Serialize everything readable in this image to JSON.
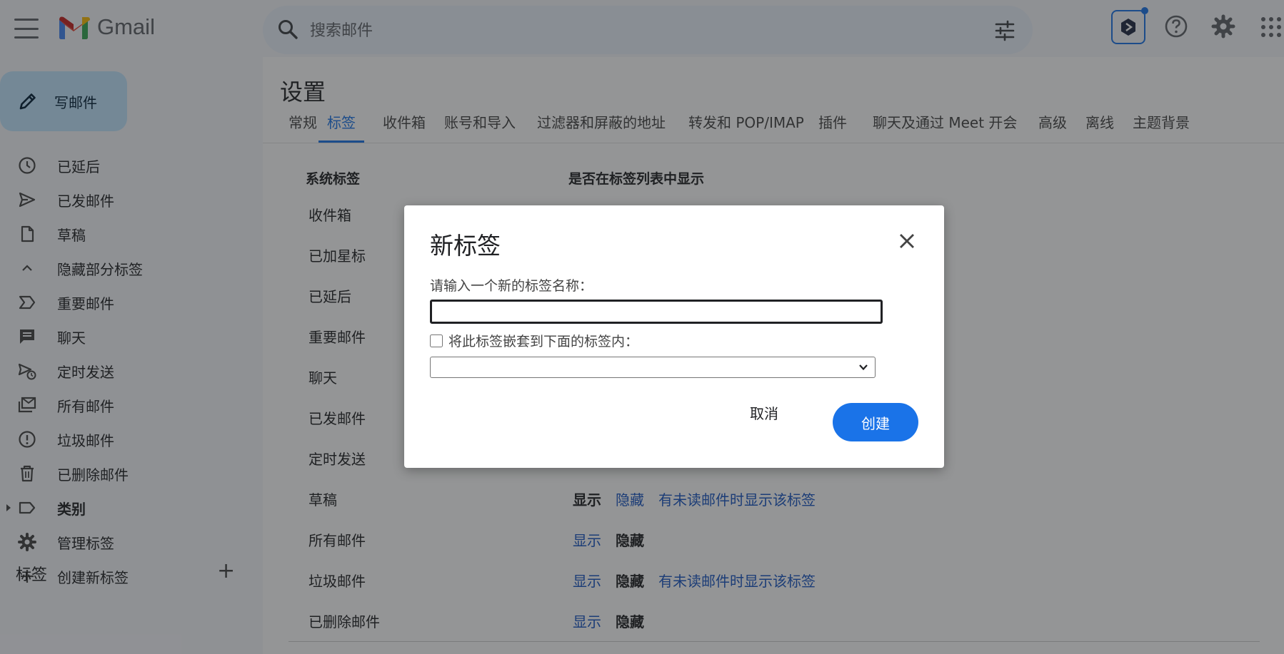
{
  "header": {
    "app_name": "Gmail",
    "search_placeholder": "搜索邮件"
  },
  "sidebar": {
    "compose_label": "写邮件",
    "items": [
      {
        "label": "已延后",
        "icon": "clock-icon"
      },
      {
        "label": "已发邮件",
        "icon": "send-icon"
      },
      {
        "label": "草稿",
        "icon": "draft-icon"
      },
      {
        "label": "隐藏部分标签",
        "icon": "chevron-up-icon"
      },
      {
        "label": "重要邮件",
        "icon": "important-icon"
      },
      {
        "label": "聊天",
        "icon": "chat-icon"
      },
      {
        "label": "定时发送",
        "icon": "scheduled-send-icon"
      },
      {
        "label": "所有邮件",
        "icon": "all-mail-icon"
      },
      {
        "label": "垃圾邮件",
        "icon": "spam-icon"
      },
      {
        "label": "已删除邮件",
        "icon": "trash-icon"
      },
      {
        "label": "类别",
        "icon": "label-icon"
      },
      {
        "label": "管理标签",
        "icon": "gear-icon"
      },
      {
        "label": "创建新标签",
        "icon": "plus-icon"
      }
    ],
    "labels_heading": "标签",
    "labels_add": "+"
  },
  "settings": {
    "title": "设置",
    "tabs": [
      "常规",
      "标签",
      "收件箱",
      "账号和导入",
      "过滤器和屏蔽的地址",
      "转发和 POP/IMAP",
      "插件",
      "聊天及通过 Meet 开会",
      "高级",
      "离线",
      "主题背景"
    ],
    "active_tab": "标签",
    "column_system_labels": "系统标签",
    "column_show_in_list": "是否在标签列表中显示",
    "rows": [
      {
        "name": "收件箱"
      },
      {
        "name": "已加星标"
      },
      {
        "name": "已延后"
      },
      {
        "name": "重要邮件"
      },
      {
        "name": "聊天"
      },
      {
        "name": "已发邮件"
      },
      {
        "name": "定时发送"
      },
      {
        "name": "草稿",
        "show": "显示",
        "hide": "隐藏",
        "unread": "有未读邮件时显示该标签"
      },
      {
        "name": "所有邮件",
        "show": "显示",
        "hide": "隐藏"
      },
      {
        "name": "垃圾邮件",
        "show": "显示",
        "hide": "隐藏",
        "unread": "有未读邮件时显示该标签"
      },
      {
        "name": "已删除邮件",
        "show": "显示",
        "hide": "隐藏"
      }
    ]
  },
  "dialog": {
    "title": "新标签",
    "prompt": "请输入一个新的标签名称：",
    "name_value": "",
    "nest_label": "将此标签嵌套到下面的标签内：",
    "nest_checked": false,
    "parent_selected": "",
    "cancel_label": "取消",
    "create_label": "创建"
  },
  "colors": {
    "accent": "#1a73e8",
    "compose_bg": "#c2e7ff",
    "link": "#1a56c4",
    "overlay": "rgba(32,33,36,0.48)"
  }
}
